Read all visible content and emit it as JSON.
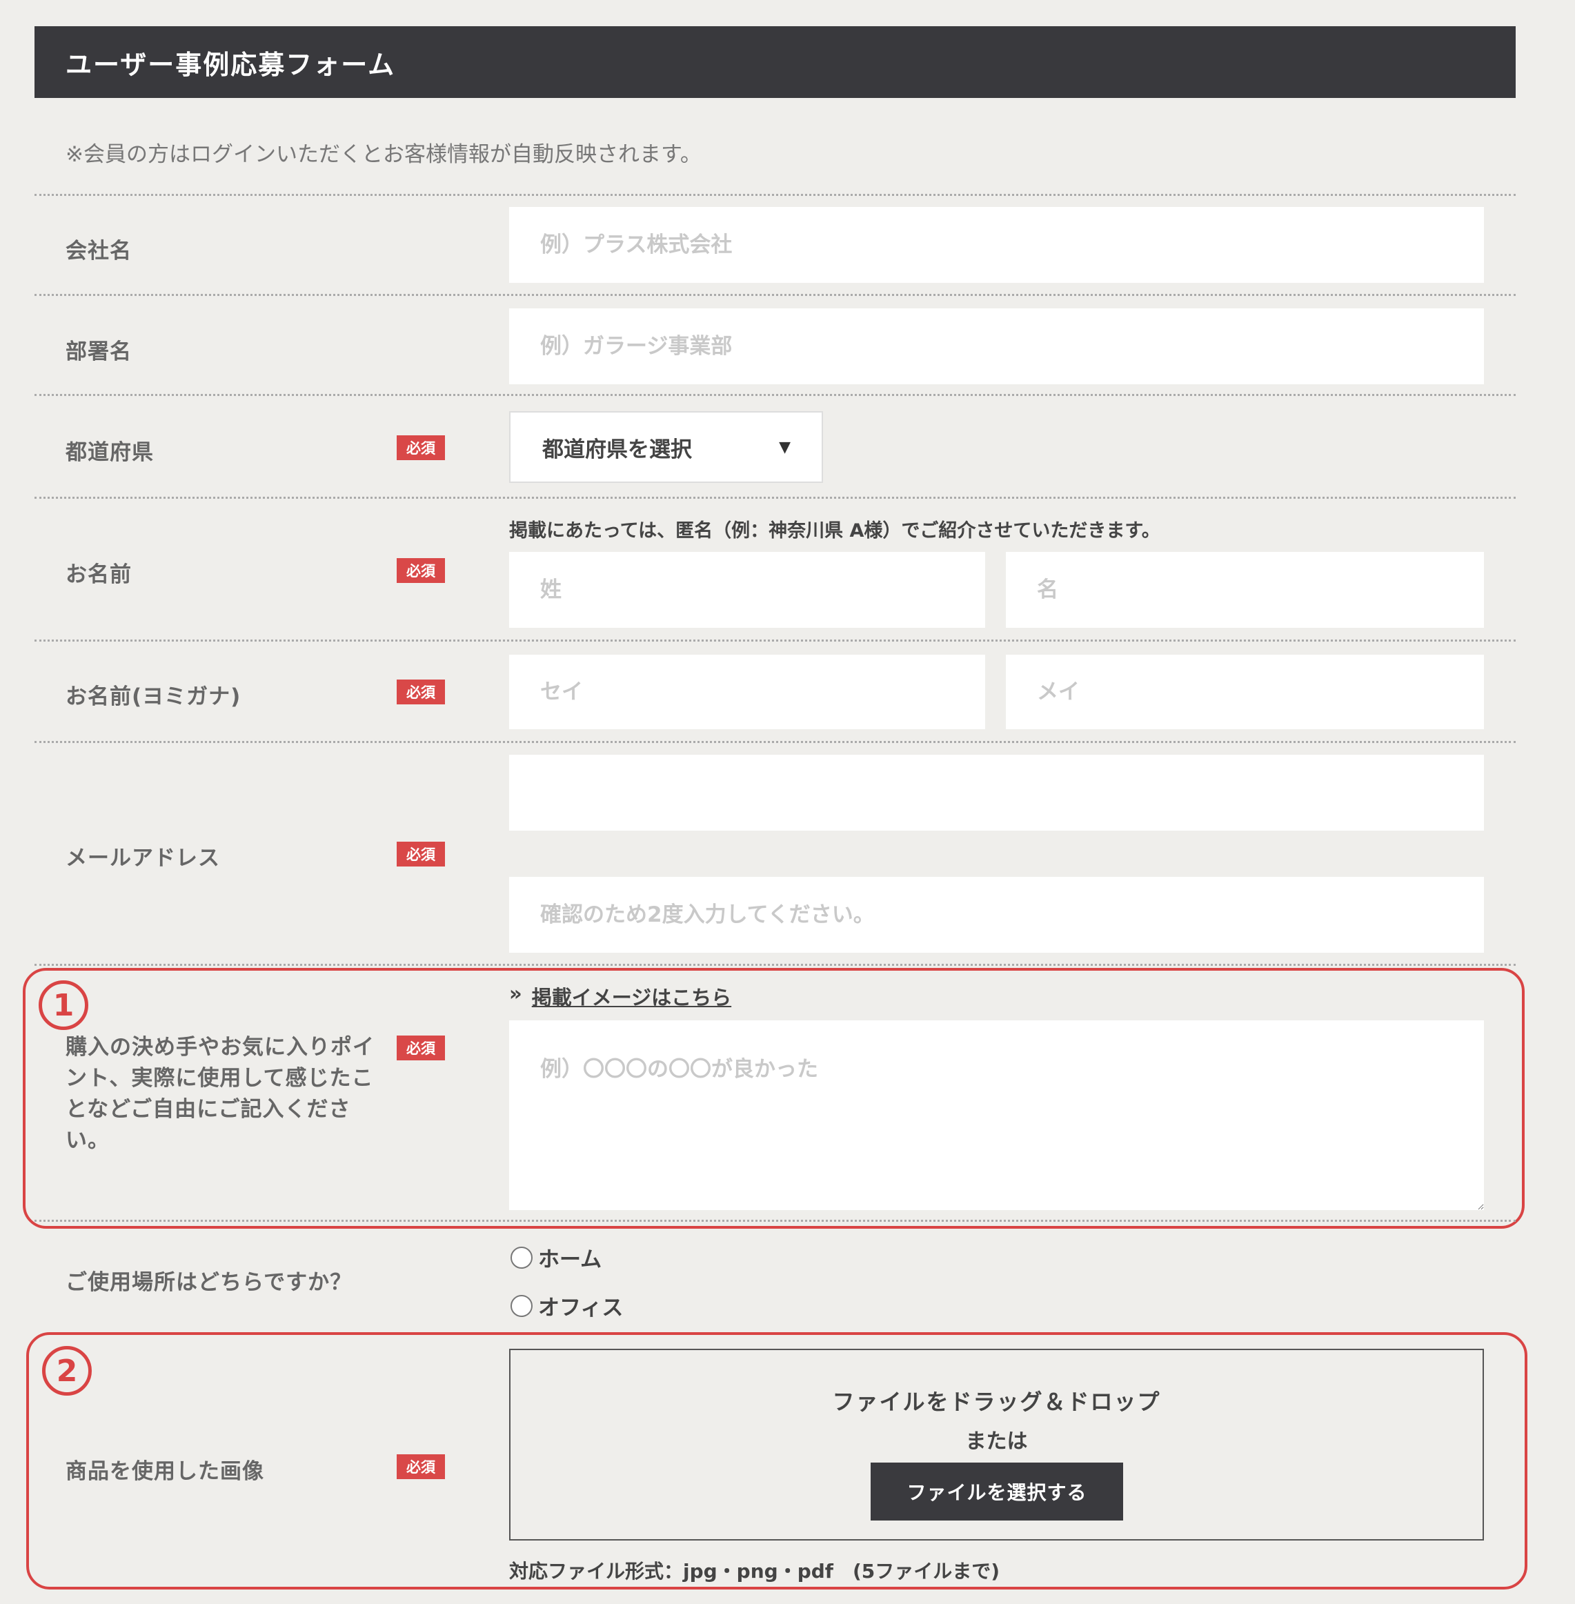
{
  "form": {
    "title": "ユーザー事例応募フォーム",
    "note": "※会員の方はログインいただくとお客様情報が自動反映されます。",
    "required_badge": "必須",
    "company": {
      "label": "会社名",
      "placeholder": "例）プラス株式会社"
    },
    "department": {
      "label": "部署名",
      "placeholder": "例）ガラージ事業部"
    },
    "prefecture": {
      "label": "都道府県",
      "select_value": "都道府県を選択",
      "arrow": "▼"
    },
    "name": {
      "label": "お名前",
      "hint": "掲載にあたっては、匿名（例：神奈川県 A様）でご紹介させていただきます。",
      "last_placeholder": "姓",
      "first_placeholder": "名"
    },
    "kana": {
      "label": "お名前(ヨミガナ)",
      "last_placeholder": "セイ",
      "first_placeholder": "メイ"
    },
    "email": {
      "label": "メールアドレス",
      "placeholder1": "",
      "placeholder2": "確認のため2度入力してください。"
    },
    "points": {
      "label": "購入の決め手やお気に入りポイント、実際に使用して感じたことなどご自由にご記入ください。",
      "link_prefix": "»",
      "link_text": "掲載イメージはこちら",
      "placeholder": "例）〇〇〇の〇〇が良かった"
    },
    "location": {
      "label": "ご使用場所はどちらですか？",
      "options": [
        "ホーム",
        "オフィス"
      ]
    },
    "image": {
      "label": "商品を使用した画像",
      "dropzone_text": "ファイルをドラッグ＆ドロップ",
      "or_text": "または",
      "button_label": "ファイルを選択する",
      "formats": "対応ファイル形式：jpg・png・pdf　(5ファイルまで)"
    }
  },
  "callouts": {
    "first": "1",
    "second": "2"
  },
  "colors": {
    "header_bg": "#39393d",
    "badge": "#d94848",
    "callout": "#d94444",
    "background": "#efeeeb"
  }
}
